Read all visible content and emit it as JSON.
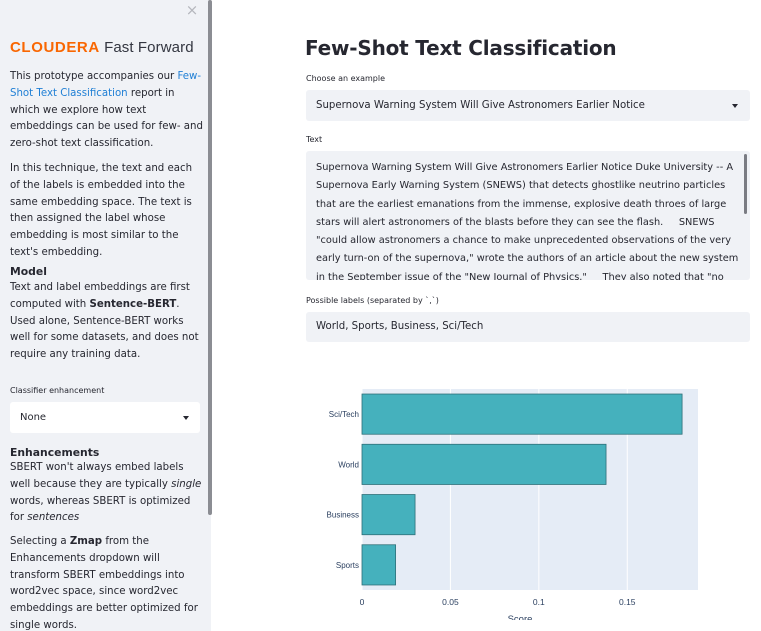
{
  "sidebar": {
    "close_glyph": "×",
    "logo_brand": "CLOUDERA",
    "logo_rest": " Fast Forward",
    "intro_prefix": "This prototype accompanies our ",
    "intro_link": "Few-Shot Text Classification",
    "intro_suffix": " report in which we explore how text embeddings can be used for few- and zero-shot text classification.",
    "technique": "In this technique, the text and each of the labels is embedded into the same embedding space. The text is then assigned the label whose embedding is most similar to the text's embedding.",
    "model_heading": "Model",
    "model_prefix": "Text and label embeddings are first computed with ",
    "model_bold": "Sentence-BERT",
    "model_suffix": ". Used alone, Sentence-BERT works well for some datasets, and does not require any training data.",
    "enhancement_label": "Classifier enhancement",
    "enhancement_value": "None",
    "enhancements_heading": "Enhancements",
    "enh_p1_a": "SBERT won't always embed labels well because they are typically ",
    "enh_p1_em1": "single",
    "enh_p1_b": " words, whereas SBERT is optimized for ",
    "enh_p1_em2": "sentences",
    "enh_p2_a": "Selecting a ",
    "enh_p2_bold": "Zmap",
    "enh_p2_b": " from the Enhancements dropdown will transform SBERT embeddings into word2vec space, since word2vec embeddings are better optimized for single words."
  },
  "main": {
    "title": "Few-Shot Text Classification",
    "example_label": "Choose an example",
    "example_value": "Supernova Warning System Will Give Astronomers Earlier Notice",
    "text_label": "Text",
    "text_value": "Supernova Warning System Will Give Astronomers Earlier Notice Duke University -- A Supernova Early Warning System (SNEWS) that detects ghostlike neutrino particles that are the earliest emanations from the immense, explosive death throes of large stars will alert astronomers of the blasts before they can see the flash.     SNEWS \"could allow astronomers a chance to make unprecedented observations of the very early turn-on of the supernova,\" wrote the authors of an article about the new system in the September issue of the \"New Journal of Physics.\"     They also noted that \"no supernova has ever been observed soon after its birth.\"     Big stars end their lives in explosive gravitational collapses as complete",
    "labels_label": "Possible labels (separated by `,`)",
    "labels_value": "World, Sports, Business, Sci/Tech"
  },
  "chart_data": {
    "type": "bar",
    "orientation": "horizontal",
    "categories": [
      "Sci/Tech",
      "World",
      "Business",
      "Sports"
    ],
    "values": [
      0.181,
      0.138,
      0.03,
      0.019
    ],
    "xlabel": "Score",
    "ylabel": "",
    "xlim": [
      0,
      0.19
    ],
    "xticks": [
      0,
      0.05,
      0.1,
      0.15
    ],
    "xtick_labels": [
      "0",
      "0.05",
      "0.1",
      "0.15"
    ],
    "bar_color": "#45b1bd",
    "bar_edge_color": "#2e6f78",
    "background": "#e5ecf6",
    "grid": true
  }
}
